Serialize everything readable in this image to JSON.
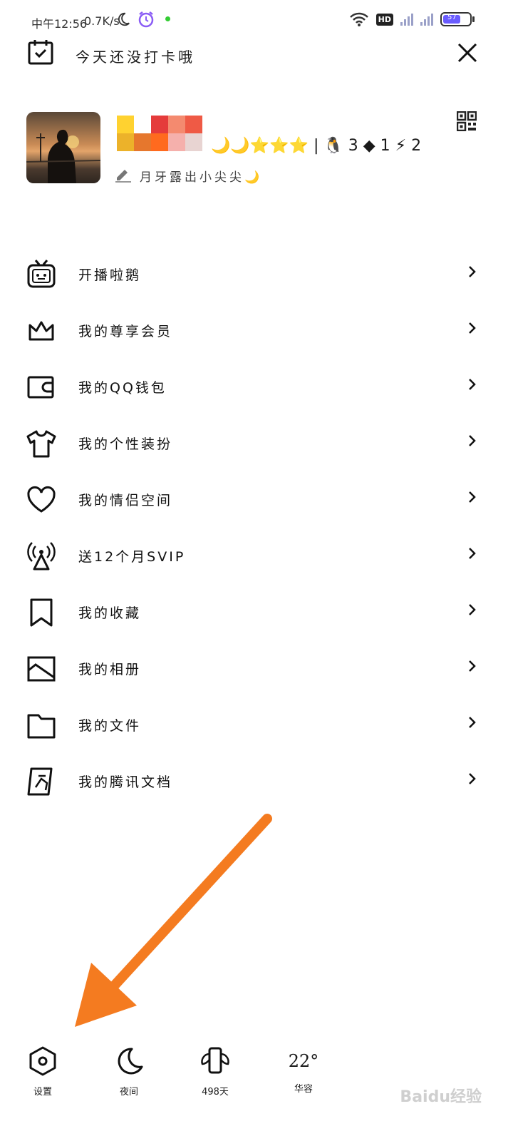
{
  "status_bar": {
    "time": "中午12:56",
    "speed": "0.7K/s",
    "hd": "HD",
    "battery": "57"
  },
  "header": {
    "checkin_text": "今天还没打卡哦"
  },
  "profile": {
    "signature": "月牙露出小尖尖🌙",
    "badges": "🌙🌙⭐⭐⭐ | 🐧 3 ◆ 1 ⚡ 2"
  },
  "menu": {
    "items": [
      {
        "label": "开播啦鹅"
      },
      {
        "label": "我的尊享会员"
      },
      {
        "label": "我的QQ钱包"
      },
      {
        "label": "我的个性装扮"
      },
      {
        "label": "我的情侣空间"
      },
      {
        "label": "送12个月SVIP"
      },
      {
        "label": "我的收藏"
      },
      {
        "label": "我的相册"
      },
      {
        "label": "我的文件"
      },
      {
        "label": "我的腾讯文档"
      }
    ]
  },
  "bottom_bar": {
    "settings": "设置",
    "night": "夜间",
    "days": "498天",
    "weather_temp": "22°",
    "weather_city": "华容"
  },
  "watermark": "Baidu经验",
  "colors": {
    "arrow": "#f47b20",
    "accent": "#6a5cff"
  }
}
